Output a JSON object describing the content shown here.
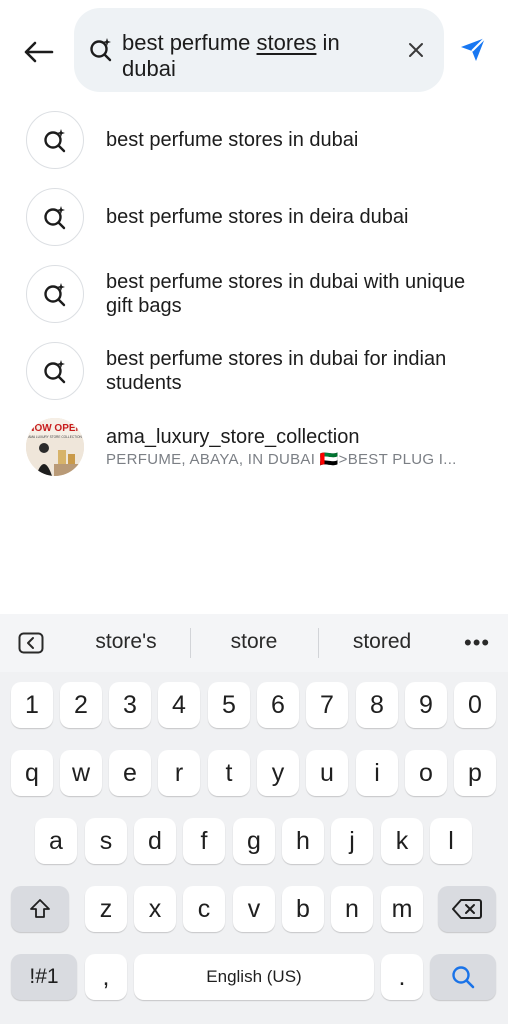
{
  "header": {
    "query_part1": "best perfume ",
    "query_underlined": "stores",
    "query_part2": " in dubai"
  },
  "suggestions": [
    {
      "text": "best perfume stores in dubai"
    },
    {
      "text": "best perfume stores in deira dubai"
    },
    {
      "text": "best perfume stores in dubai with unique gift bags"
    },
    {
      "text": "best perfume stores in dubai for indian students"
    }
  ],
  "profile": {
    "name": "ama_luxury_store_collection",
    "subtitle": "PERFUME, ABAYA, IN DUBAI 🇦🇪>BEST PLUG I...",
    "image_text_line1": "NOW OPEN",
    "image_text_line2": "AMA LUXURY STORE COLLECTION"
  },
  "keyboard": {
    "predictions": [
      "store's",
      "store",
      "stored"
    ],
    "more": "•••",
    "row_numbers": [
      "1",
      "2",
      "3",
      "4",
      "5",
      "6",
      "7",
      "8",
      "9",
      "0"
    ],
    "row1": [
      "q",
      "w",
      "e",
      "r",
      "t",
      "y",
      "u",
      "i",
      "o",
      "p"
    ],
    "row2": [
      "a",
      "s",
      "d",
      "f",
      "g",
      "h",
      "j",
      "k",
      "l"
    ],
    "row3": [
      "z",
      "x",
      "c",
      "v",
      "b",
      "n",
      "m"
    ],
    "symbols_label": "!#1",
    "comma": ",",
    "space_label": "English (US)",
    "period": "."
  },
  "colors": {
    "search_bg": "#eef2f5",
    "send_blue": "#1877f2",
    "keyboard_bg": "#f0f1f3",
    "search_key_icon": "#1a73e8"
  }
}
